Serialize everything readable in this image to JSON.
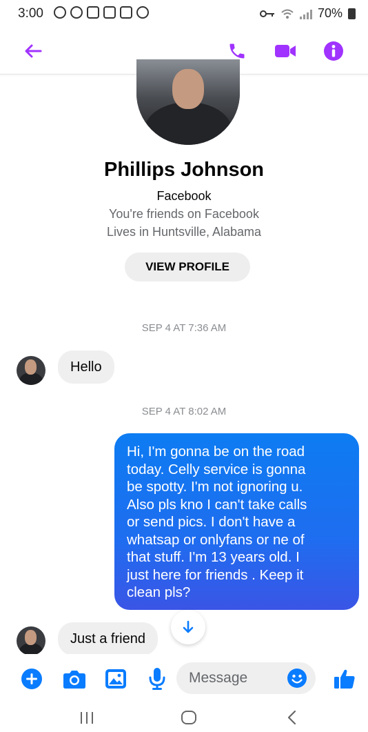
{
  "status_bar": {
    "time": "3:00",
    "battery": "70%"
  },
  "header": {
    "back_icon": "arrow-left-icon",
    "call_icon": "phone-icon",
    "video_icon": "video-camera-icon",
    "info_icon": "info-icon",
    "accent_color": "#a033ff"
  },
  "profile": {
    "name": "Phillips Johnson",
    "source": "Facebook",
    "friends_text": "You're friends on Facebook",
    "location": "Lives in Huntsville, Alabama",
    "view_profile_label": "VIEW PROFILE"
  },
  "messages": {
    "timestamp_1": "SEP 4 AT 7:36 AM",
    "hello": "Hello",
    "timestamp_2": "SEP 4 AT 8:02 AM",
    "sent_lines": [
      "Hi,  I'm gonna be on the road",
      "today.  Celly service is gonna",
      "be spotty.  I'm not ignoring u.",
      "Also pls kno I can't take calls",
      "or send pics.  I don't have a",
      "whatsap or onlyfans or ne of",
      "that stuff.  I'm 13 years old.  I",
      "just here for friends .  Keep it",
      "clean pls?"
    ],
    "just_a_friend": "Just a friend",
    "sent_bubble_color": "#1f6df0"
  },
  "composer": {
    "placeholder": "Message",
    "icons": [
      "plus-icon",
      "camera-icon",
      "gallery-icon",
      "microphone-icon",
      "emoji-icon",
      "thumbs-up-icon"
    ],
    "icon_color": "#0a7cff"
  }
}
